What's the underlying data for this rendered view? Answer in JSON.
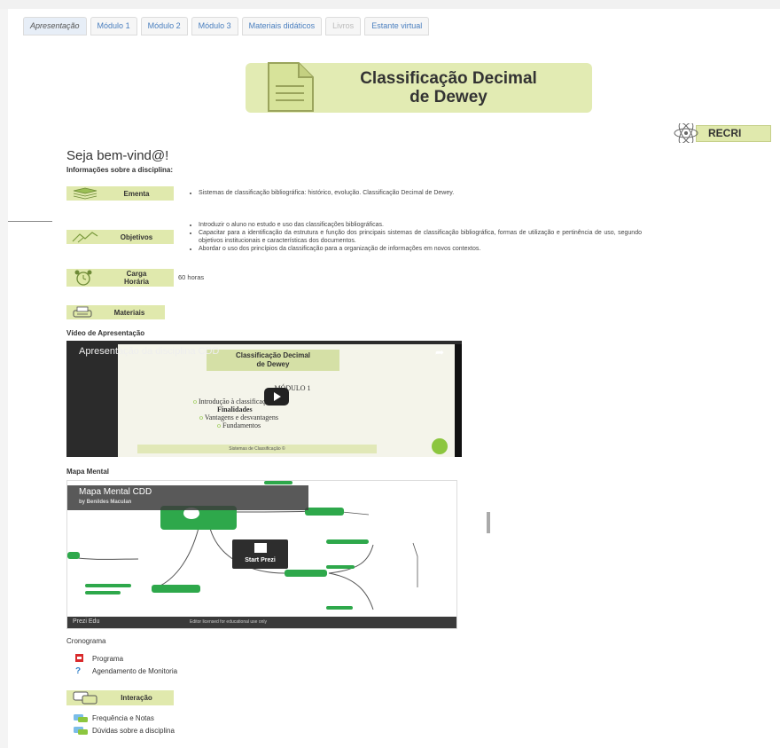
{
  "tabs": [
    {
      "label": "Apresentação",
      "state": "active"
    },
    {
      "label": "Módulo 1",
      "state": "normal"
    },
    {
      "label": "Módulo 2",
      "state": "normal"
    },
    {
      "label": "Módulo 3",
      "state": "normal"
    },
    {
      "label": "Materiais didáticos",
      "state": "normal"
    },
    {
      "label": "Livros",
      "state": "disabled"
    },
    {
      "label": "Estante virtual",
      "state": "normal"
    }
  ],
  "banner": {
    "title_line1": "Classificação Decimal",
    "title_line2": "de Dewey",
    "icon": "document-icon"
  },
  "recri": {
    "label": "RECRI",
    "icon": "atom-icon"
  },
  "welcome": "Seja bem-vind@!",
  "info_heading": "Informações sobre a disciplina:",
  "ementa": {
    "label": "Ementa",
    "icon": "books-icon",
    "bullets": [
      "Sistemas de classificação bibliográfica: histórico, evolução. Classificação Decimal de Dewey."
    ]
  },
  "objetivos": {
    "label": "Objetivos",
    "icon": "objectives-icon",
    "bullets": [
      "Introduzir o aluno no estudo e uso das classificações bibliográficas.",
      "Capacitar para a identificação da estrutura e função dos principais sistemas de classificação bibliográfica, formas de utilização e pertinência de uso, segundo objetivos institucionais e características dos documentos.",
      "Abordar o uso dos princípios da classificação para a organização de informações em novos contextos."
    ]
  },
  "carga": {
    "label_line1": "Carga",
    "label_line2": "Horária",
    "icon": "alarm-clock-icon",
    "value": "60 horas"
  },
  "materiais": {
    "label": "Materiais",
    "icon": "printer-icon"
  },
  "video": {
    "heading": "Vídeo de Apresentação",
    "title": "Apresentação da disciplina CDD",
    "slide_title_line1": "Classificação Decimal",
    "slide_title_line2": "de Dewey",
    "modulo": "MÓDULO 1",
    "items": [
      "Introdução à classificação",
      "Finalidades",
      "Vantagens e desvantagens",
      "Fundamentos"
    ],
    "footer": "Sistemas de Classificação ©"
  },
  "mapa": {
    "heading": "Mapa Mental",
    "title": "Mapa Mental CDD",
    "author": "by Benildes Maculan",
    "start": "Start Prezi",
    "brand": "Prezi Edu",
    "license": "Editor licensed for educational use only"
  },
  "cronograma": {
    "heading": "Cronograma",
    "links": [
      {
        "label": "Programa",
        "icon": "pdf-icon"
      },
      {
        "label": "Agendamento de Monitoria",
        "icon": "help-icon"
      }
    ]
  },
  "interacao": {
    "label": "Interação",
    "icon": "chat-icon",
    "links": [
      {
        "label": "Frequência e Notas",
        "icon": "forum-icon"
      },
      {
        "label": "Dúvidas sobre a disciplina",
        "icon": "forum-icon"
      }
    ]
  }
}
